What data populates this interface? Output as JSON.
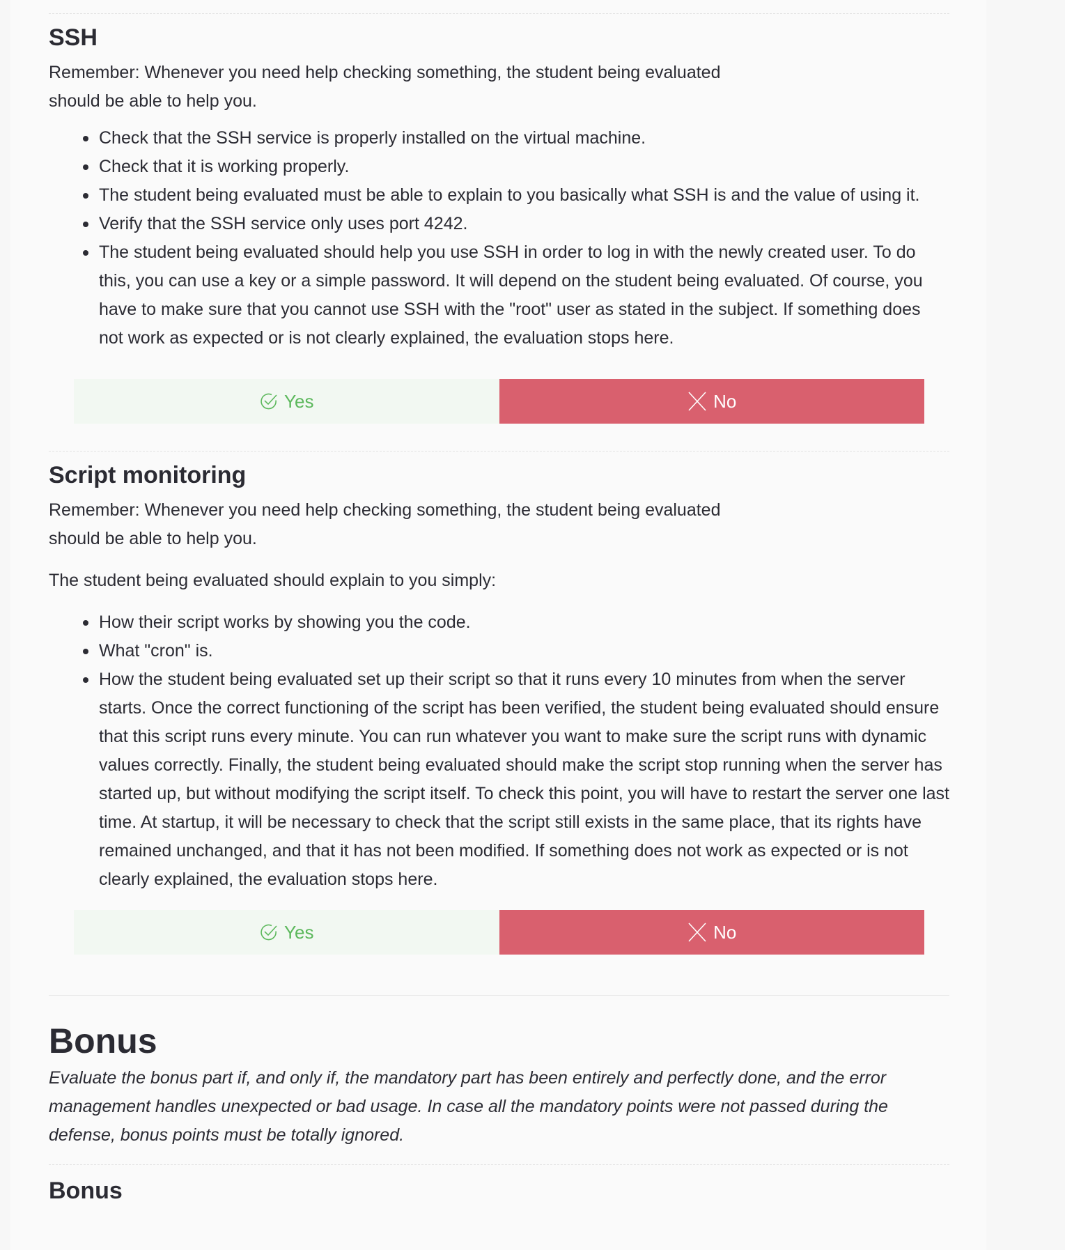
{
  "ssh": {
    "title": "SSH",
    "remember_line1": "Remember: Whenever you need help checking something, the student being evaluated",
    "remember_line2": "should be able to help you.",
    "bullets": [
      "Check that the SSH service is properly installed on the virtual machine.",
      "Check that it is working properly.",
      "The student being evaluated must be able to explain to you basically what SSH is and the value of using it.",
      "Verify that the SSH service only uses port 4242.",
      "The student being evaluated should help you use SSH in order to log in with the newly created user. To do this, you can use a key or a simple password. It will depend on the student being evaluated. Of course, you have to make sure that you cannot use SSH with the \"root\" user as stated in the subject. If something does not work as expected or is not clearly explained, the evaluation stops here."
    ],
    "yes_label": "Yes",
    "no_label": "No"
  },
  "script_monitoring": {
    "title": "Script monitoring",
    "remember_line1": "Remember: Whenever you need help checking something, the student being evaluated",
    "remember_line2": "should be able to help you.",
    "intro": "The student being evaluated should explain to you simply:",
    "bullets": [
      "How their script works by showing you the code.",
      "What \"cron\" is.",
      "How the student being evaluated set up their script so that it runs every 10 minutes from when the server starts. Once the correct functioning of the script has been verified, the student being evaluated should ensure that this script runs every minute. You can run whatever you want to make sure the script runs with dynamic values correctly. Finally, the student being evaluated should make the script stop running when the server has started up, but without modifying the script itself. To check this point, you will have to restart the server one last time. At startup, it will be necessary to check that the script still exists in the same place, that its rights have remained unchanged, and that it has not been modified. If something does not work as expected or is not clearly explained, the evaluation stops here."
    ],
    "yes_label": "Yes",
    "no_label": "No"
  },
  "bonus_part": {
    "title": "Bonus",
    "description": "Evaluate the bonus part if, and only if, the mandatory part has been entirely and perfectly done, and the error management handles unexpected or bad usage. In case all the mandatory points were not passed during the defense, bonus points must be totally ignored."
  },
  "bonus_section": {
    "title": "Bonus"
  },
  "colors": {
    "yes_bg": "#f2f8f2",
    "yes_text": "#5cb85c",
    "no_bg": "#d9606e",
    "no_text": "#ffffff",
    "text": "#2b2b33"
  },
  "icons": {
    "yes": "check-circle-icon",
    "no": "close-x-icon"
  }
}
